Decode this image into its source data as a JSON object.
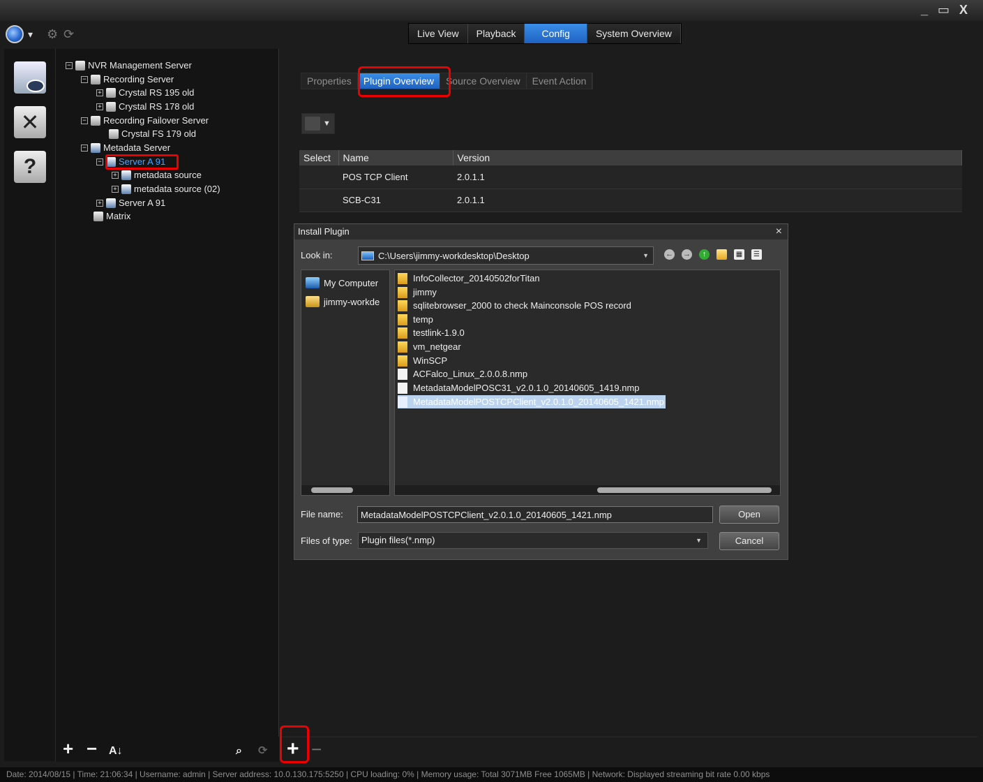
{
  "window": {
    "controls": [
      "_",
      "▭",
      "X"
    ]
  },
  "app": {
    "globe_icon": "globe-icon",
    "menu_chevron": "▾"
  },
  "top_tabs": [
    {
      "label": "Live View",
      "active": false
    },
    {
      "label": "Playback",
      "active": false
    },
    {
      "label": "Config",
      "active": true
    },
    {
      "label": "System Overview",
      "active": false
    }
  ],
  "tree": {
    "root": "NVR Management Server",
    "recording_server": "Recording Server",
    "crystal_rs_195": "Crystal RS 195 old",
    "crystal_rs_178": "Crystal RS 178 old",
    "failover_server": "Recording Failover Server",
    "crystal_fs_179": "Crystal FS 179 old",
    "metadata_server": "Metadata Server",
    "server_a91_selected": "Server A 91",
    "metadata_source": "metadata source",
    "metadata_source_02": "metadata source (02)",
    "server_a91": "Server A 91",
    "matrix": "Matrix"
  },
  "sub_tabs": [
    {
      "label": "Properties",
      "active": false
    },
    {
      "label": "Plugin Overview",
      "active": true
    },
    {
      "label": "Source Overview",
      "active": false
    },
    {
      "label": "Event Action",
      "active": false
    }
  ],
  "plugin_table": {
    "headers": [
      "Select",
      "Name",
      "Version"
    ],
    "rows": [
      {
        "name": "POS TCP Client",
        "version": "2.0.1.1"
      },
      {
        "name": "SCB-C31",
        "version": "2.0.1.1"
      }
    ]
  },
  "dialog": {
    "title": "Install Plugin",
    "close": "×",
    "look_in_label": "Look in:",
    "look_in_path": "C:\\Users\\jimmy-workdesktop\\Desktop",
    "places": [
      "My Computer",
      "jimmy-workde"
    ],
    "files": [
      {
        "name": "InfoCollector_20140502forTitan",
        "type": "folder"
      },
      {
        "name": "jimmy",
        "type": "folder"
      },
      {
        "name": "sqlitebrowser_2000 to check Mainconsole POS record",
        "type": "folder"
      },
      {
        "name": "temp",
        "type": "folder"
      },
      {
        "name": "testlink-1.9.0",
        "type": "folder"
      },
      {
        "name": "vm_netgear",
        "type": "folder"
      },
      {
        "name": "WinSCP",
        "type": "folder"
      },
      {
        "name": "ACFalco_Linux_2.0.0.8.nmp",
        "type": "file"
      },
      {
        "name": "MetadataModelPOSC31_v2.0.1.0_20140605_1419.nmp",
        "type": "file"
      },
      {
        "name": "MetadataModelPOSTCPClient_v2.0.1.0_20140605_1421.nmp",
        "type": "file",
        "selected": true
      }
    ],
    "file_name_label": "File name:",
    "file_name_value": "MetadataModelPOSTCPClient_v2.0.1.0_20140605_1421.nmp",
    "files_of_type_label": "Files of type:",
    "files_of_type_value": "Plugin files(*.nmp)",
    "open_label": "Open",
    "cancel_label": "Cancel"
  },
  "status_bar": {
    "text": "Date: 2014/08/15  |  Time: 21:06:34  |  Username: admin  |  Server address: 10.0.130.175:5250  |  CPU loading: 0%  |  Memory usage: Total 3071MB  Free 1065MB  |  Network: Displayed streaming bit rate    0.00 kbps"
  },
  "colors": {
    "accent": "#2f7ad8",
    "highlight": "#e00000",
    "background": "#1c1c1c"
  }
}
